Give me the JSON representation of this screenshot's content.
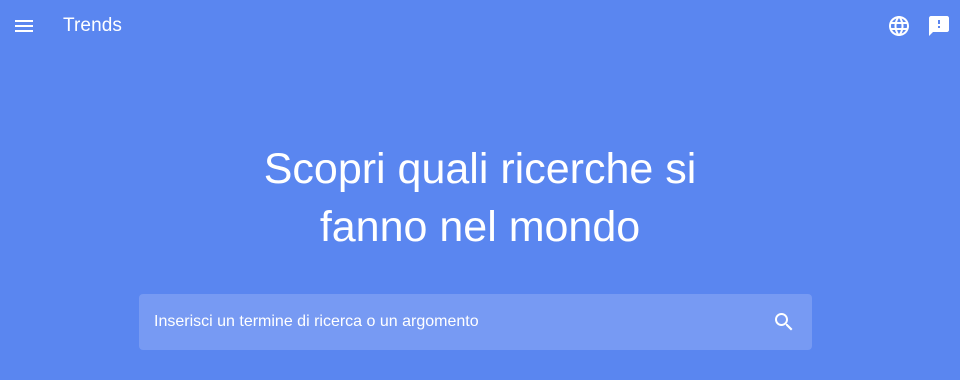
{
  "header": {
    "title": "Trends",
    "menu_icon": "hamburger-menu-icon",
    "language_icon": "globe-icon",
    "feedback_icon": "feedback-icon"
  },
  "hero": {
    "line1": "Scopri quali ricerche si",
    "line2": "fanno nel mondo"
  },
  "search": {
    "placeholder": "Inserisci un termine di ricerca o un argomento",
    "value": "",
    "icon": "search-icon"
  },
  "colors": {
    "background": "#5a86f0",
    "search_box": "#779af3",
    "foreground": "#ffffff"
  }
}
